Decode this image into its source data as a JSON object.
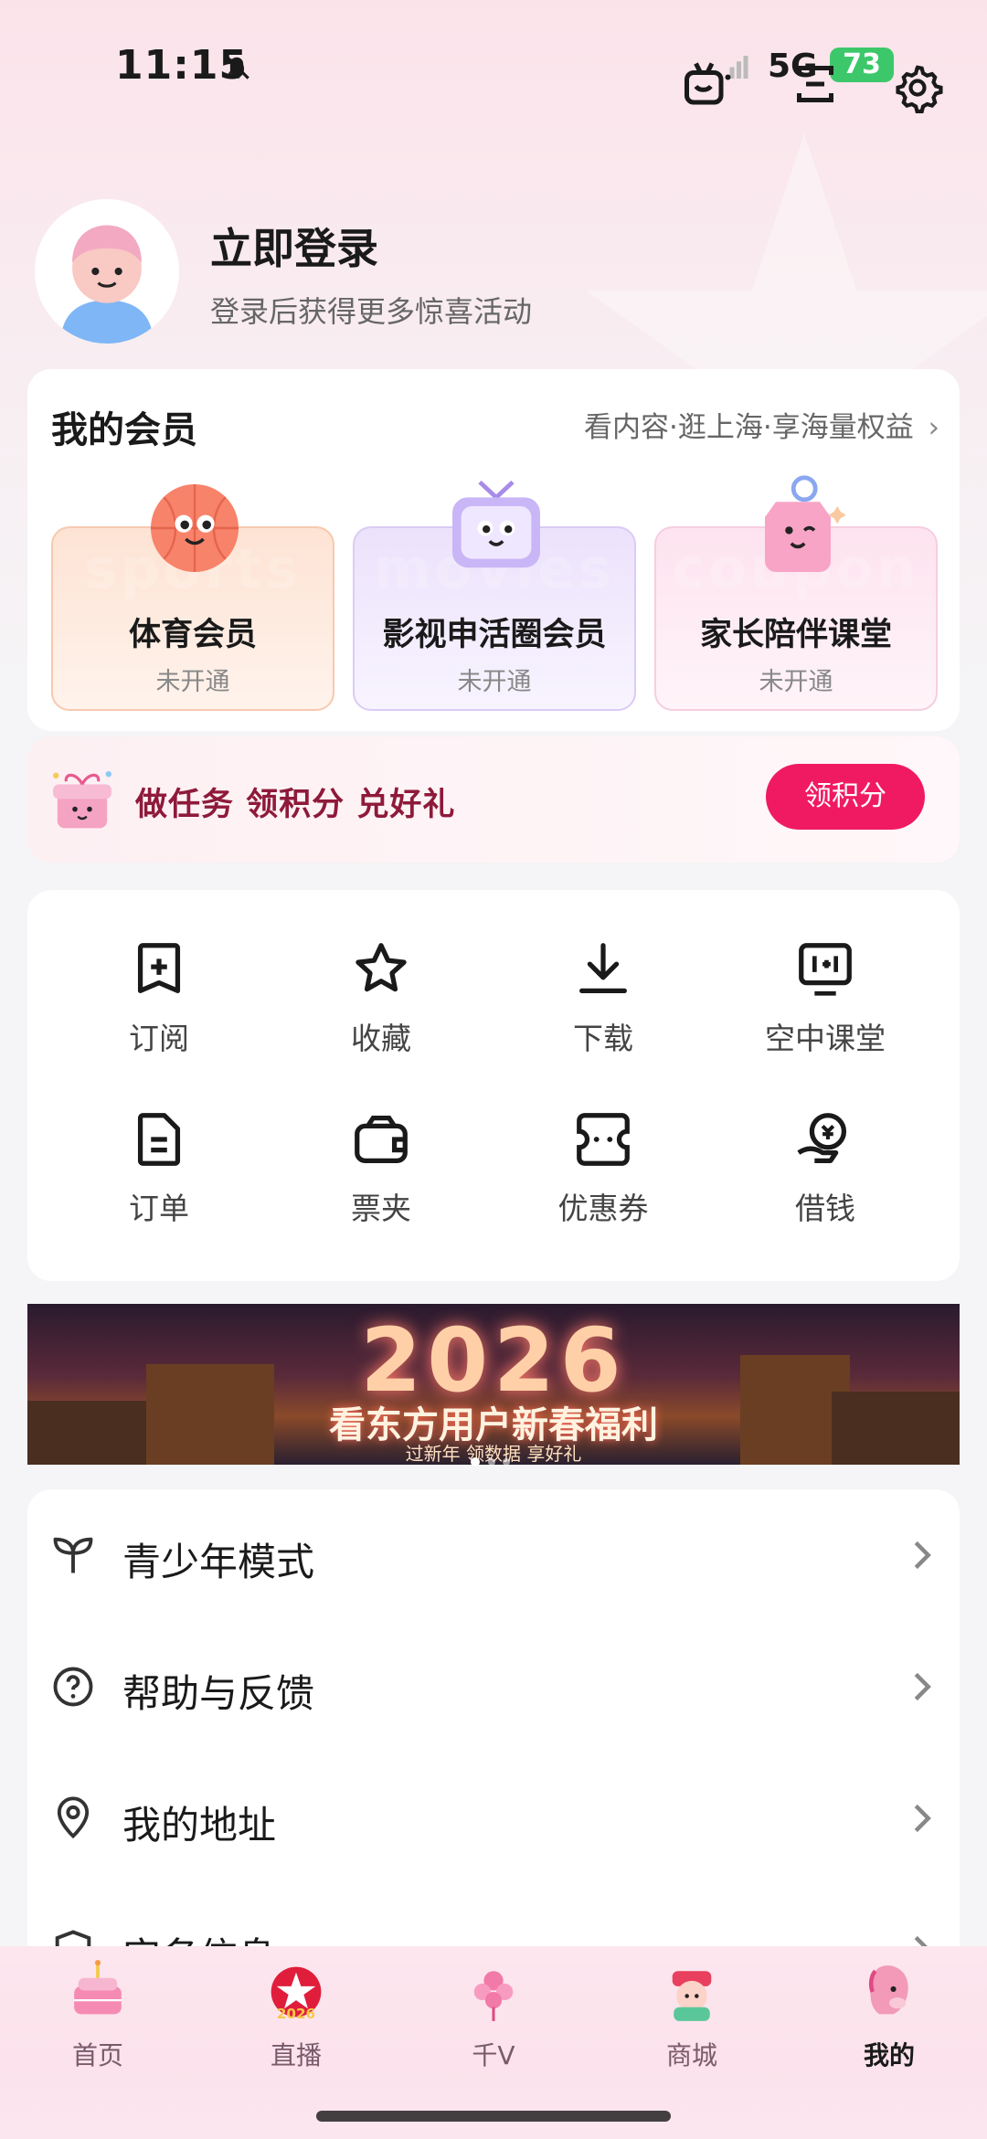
{
  "status_bar": {
    "time": "11:15",
    "network": "5G",
    "battery": "73"
  },
  "profile": {
    "title": "立即登录",
    "subtitle": "登录后获得更多惊喜活动"
  },
  "membership": {
    "title": "我的会员",
    "link": "看内容·逛上海·享海量权益",
    "cards": [
      {
        "name": "体育会员",
        "status": "未开通",
        "ghost": "sports"
      },
      {
        "name": "影视申活圈会员",
        "status": "未开通",
        "ghost": "movies"
      },
      {
        "name": "家长陪伴课堂",
        "status": "未开通",
        "ghost": "coupon"
      }
    ]
  },
  "task": {
    "text": "做任务 领积分 兑好礼",
    "button": "领积分"
  },
  "features": [
    {
      "label": "订阅",
      "icon": "subscribe-icon"
    },
    {
      "label": "收藏",
      "icon": "star-icon"
    },
    {
      "label": "下载",
      "icon": "download-icon"
    },
    {
      "label": "空中课堂",
      "icon": "classroom-icon"
    },
    {
      "label": "订单",
      "icon": "order-icon"
    },
    {
      "label": "票夹",
      "icon": "wallet-icon"
    },
    {
      "label": "优惠券",
      "icon": "coupon-icon"
    },
    {
      "label": "借钱",
      "icon": "loan-icon"
    }
  ],
  "banner": {
    "year": "2026",
    "title": "看东方用户新春福利",
    "subtitle": "过新年 领数据 享好礼"
  },
  "menu": [
    {
      "label": "青少年模式",
      "icon": "sprout-icon"
    },
    {
      "label": "帮助与反馈",
      "icon": "help-icon"
    },
    {
      "label": "我的地址",
      "icon": "location-icon"
    },
    {
      "label": "实名信息",
      "icon": "shield-icon"
    }
  ],
  "bottom_nav": [
    {
      "label": "首页",
      "active": false
    },
    {
      "label": "直播",
      "active": false
    },
    {
      "label": "千V",
      "active": false
    },
    {
      "label": "商城",
      "active": false
    },
    {
      "label": "我的",
      "active": true
    }
  ],
  "colors": {
    "accent": "#f01a63",
    "task_text": "#8e1a3a",
    "battery": "#3cc86a"
  }
}
